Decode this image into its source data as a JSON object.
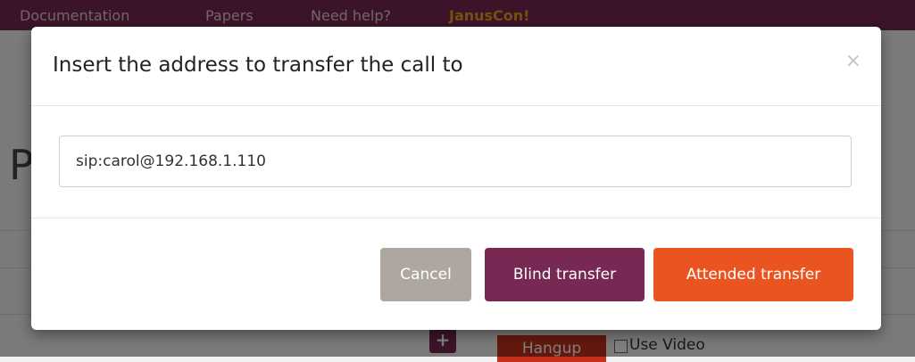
{
  "navbar": {
    "links": [
      {
        "label": "Documentation"
      },
      {
        "label": "Papers"
      },
      {
        "label": "Need help?"
      },
      {
        "label": "JanusCon!"
      }
    ]
  },
  "background": {
    "heading": "P",
    "add_icon": "plus-icon",
    "hangup_label": "Hangup",
    "use_video_label": "Use Video"
  },
  "modal": {
    "title": "Insert the address to transfer the call to",
    "close_glyph": "×",
    "address_value": "sip:carol@192.168.1.110",
    "buttons": {
      "cancel": "Cancel",
      "blind": "Blind transfer",
      "attended": "Attended transfer"
    }
  },
  "colors": {
    "brand_purple": "#772953",
    "accent_orange": "#e95420",
    "cancel_gray": "#aea79f",
    "hangup_red": "#c7311b",
    "januscon_gold": "#e9a31a"
  }
}
